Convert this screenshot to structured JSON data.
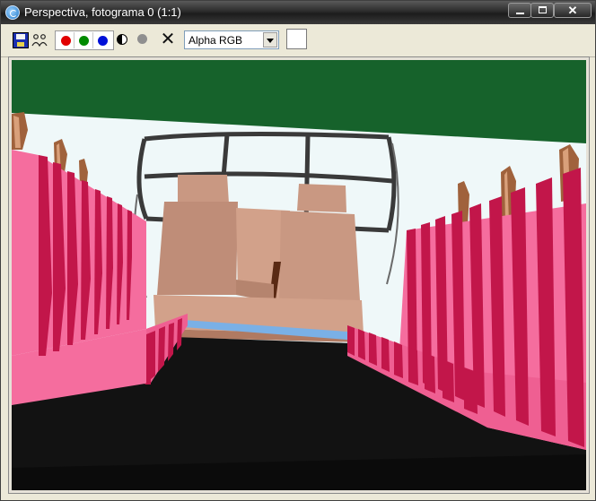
{
  "window": {
    "title": "Perspectiva, fotograma 0 (1:1)",
    "close_glyph": "✕"
  },
  "toolbar": {
    "channel_select": {
      "value": "Alpha RGB"
    },
    "swatch_color": "#ffffff",
    "channels": [
      {
        "name": "red",
        "color": "#e10000"
      },
      {
        "name": "green",
        "color": "#008a00"
      },
      {
        "name": "blue",
        "color": "#0010d8"
      }
    ],
    "icons": [
      "save-icon",
      "clone-icon",
      "monochrome-icon",
      "alpha-icon",
      "clear-icon"
    ]
  },
  "render": {
    "colors": {
      "ceiling": "#16622b",
      "walls": "#eff8f9",
      "floor": "#121212",
      "seat_pink": "#f56d9e",
      "seat_stripe": "#c2164a",
      "cabin": "#c99882",
      "window_frame": "#3a3a3a",
      "rail": "#7ab0e6",
      "post": "#a0623c"
    }
  }
}
